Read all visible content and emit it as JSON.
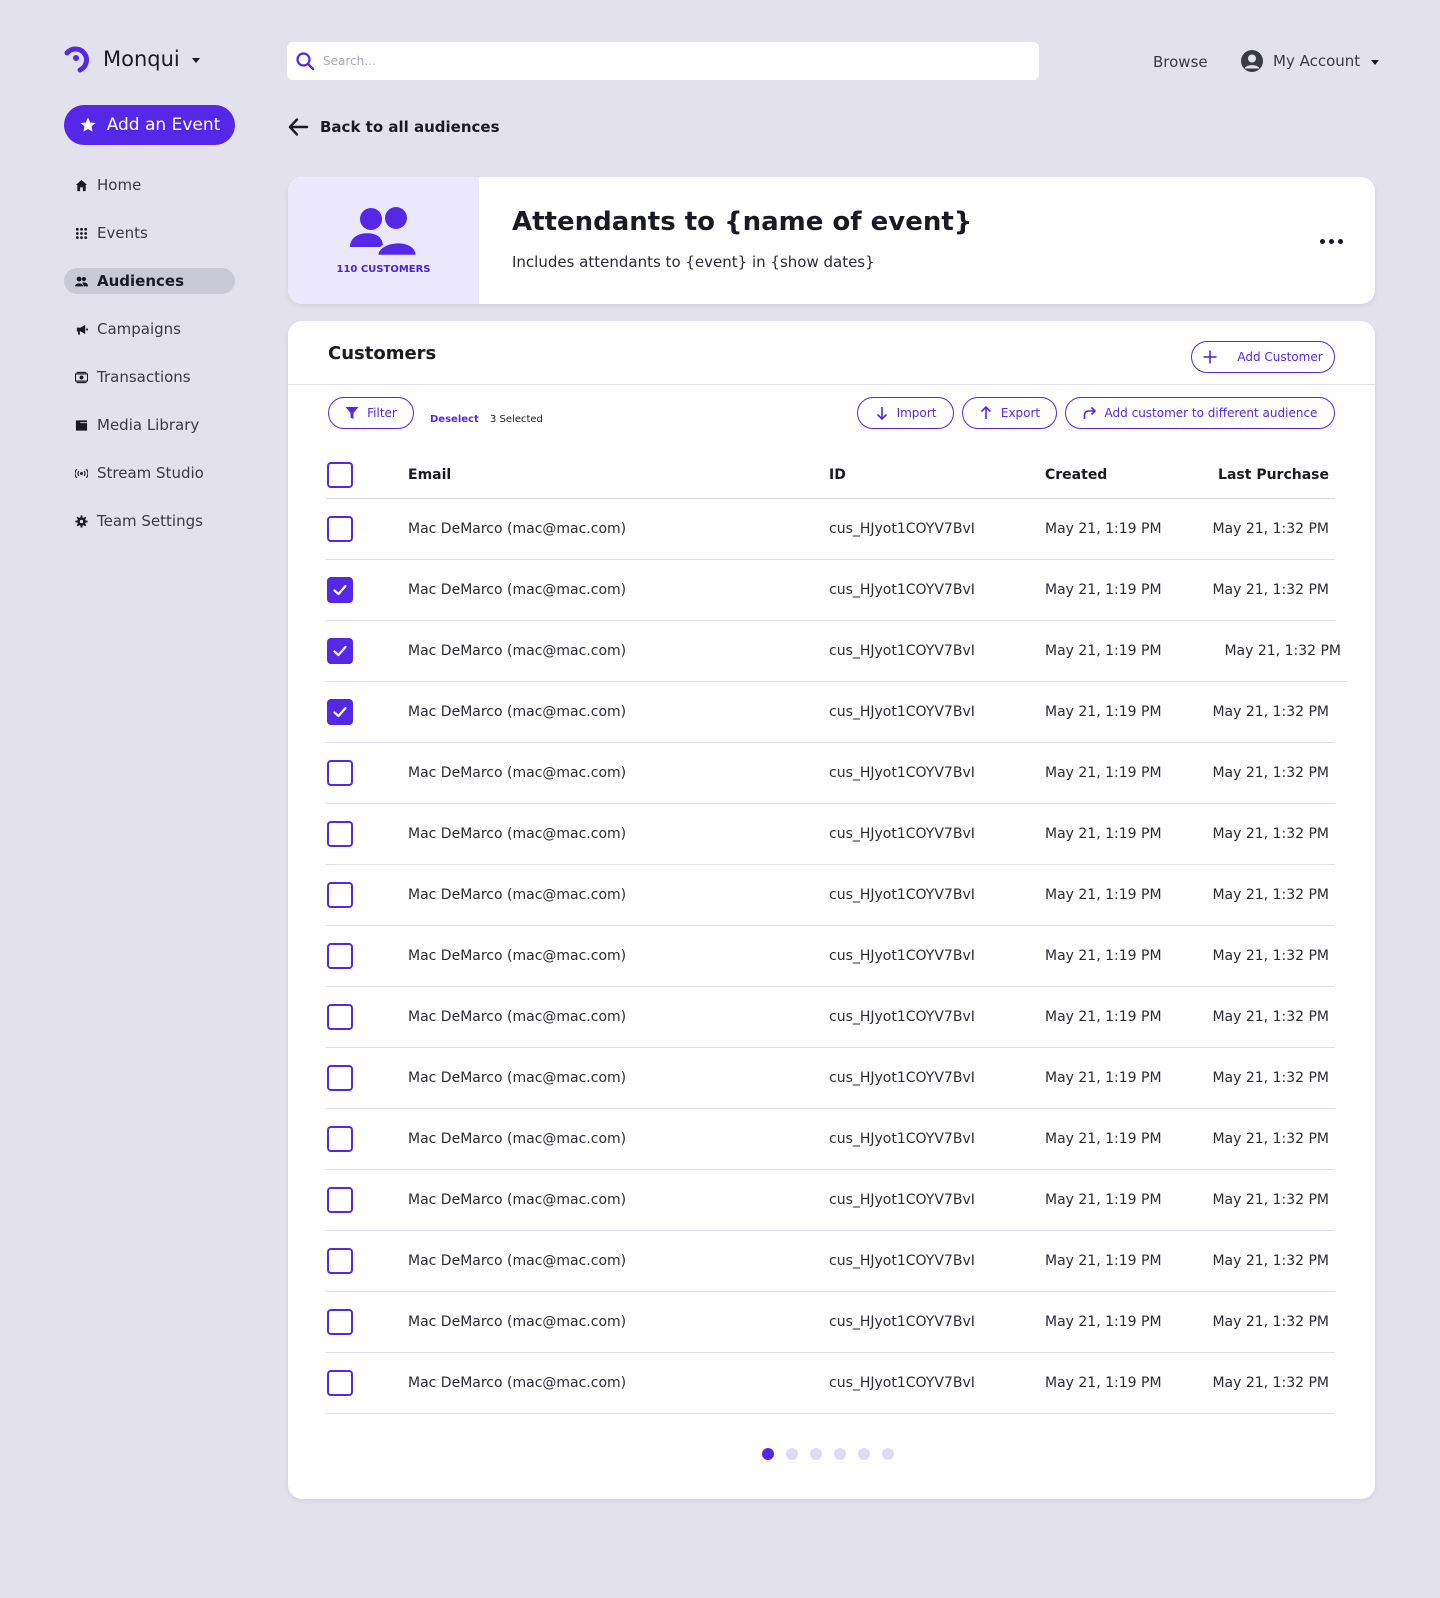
{
  "brand": {
    "name": "Monqui"
  },
  "search": {
    "placeholder": "Search..."
  },
  "header": {
    "browse": "Browse",
    "account": "My Account"
  },
  "sidebar": {
    "add_event": "Add an Event",
    "items": [
      {
        "label": "Home",
        "icon": "home-icon"
      },
      {
        "label": "Events",
        "icon": "grid-icon"
      },
      {
        "label": "Audiences",
        "icon": "users-icon",
        "active": true
      },
      {
        "label": "Campaigns",
        "icon": "megaphone-icon"
      },
      {
        "label": "Transactions",
        "icon": "money-icon"
      },
      {
        "label": "Media Library",
        "icon": "folder-icon"
      },
      {
        "label": "Stream Studio",
        "icon": "broadcast-icon"
      },
      {
        "label": "Team Settings",
        "icon": "gear-icon"
      }
    ]
  },
  "back": {
    "label": "Back to all audiences"
  },
  "audience": {
    "count_label": "110 CUSTOMERS",
    "title": "Attendants to {name of event}",
    "subtitle": "Includes attendants to {event} in {show dates}"
  },
  "customers": {
    "title": "Customers",
    "add_customer": "Add Customer",
    "filter": "Filter",
    "deselect": "Deselect",
    "selected_count": "3 Selected",
    "import": "Import",
    "export": "Export",
    "move": "Add customer to different audience",
    "columns": {
      "email": "Email",
      "id": "ID",
      "created": "Created",
      "last_purchase": "Last Purchase"
    },
    "rows": [
      {
        "email": "Mac DeMarco (mac@mac.com)",
        "id": "cus_HJyot1COYV7BvI",
        "created": "May 21, 1:19 PM",
        "last_purchase": "May 21, 1:32 PM",
        "checked": false
      },
      {
        "email": "Mac DeMarco (mac@mac.com)",
        "id": "cus_HJyot1COYV7BvI",
        "created": "May 21, 1:19 PM",
        "last_purchase": "May 21, 1:32 PM",
        "checked": true
      },
      {
        "email": "Mac DeMarco (mac@mac.com)",
        "id": "cus_HJyot1COYV7BvI",
        "created": "May 21, 1:19 PM",
        "last_purchase": "May 21, 1:32 PM",
        "checked": true
      },
      {
        "email": "Mac DeMarco (mac@mac.com)",
        "id": "cus_HJyot1COYV7BvI",
        "created": "May 21, 1:19 PM",
        "last_purchase": "May 21, 1:32 PM",
        "checked": true
      },
      {
        "email": "Mac DeMarco (mac@mac.com)",
        "id": "cus_HJyot1COYV7BvI",
        "created": "May 21, 1:19 PM",
        "last_purchase": "May 21, 1:32 PM",
        "checked": false
      },
      {
        "email": "Mac DeMarco (mac@mac.com)",
        "id": "cus_HJyot1COYV7BvI",
        "created": "May 21, 1:19 PM",
        "last_purchase": "May 21, 1:32 PM",
        "checked": false
      },
      {
        "email": "Mac DeMarco (mac@mac.com)",
        "id": "cus_HJyot1COYV7BvI",
        "created": "May 21, 1:19 PM",
        "last_purchase": "May 21, 1:32 PM",
        "checked": false
      },
      {
        "email": "Mac DeMarco (mac@mac.com)",
        "id": "cus_HJyot1COYV7BvI",
        "created": "May 21, 1:19 PM",
        "last_purchase": "May 21, 1:32 PM",
        "checked": false
      },
      {
        "email": "Mac DeMarco (mac@mac.com)",
        "id": "cus_HJyot1COYV7BvI",
        "created": "May 21, 1:19 PM",
        "last_purchase": "May 21, 1:32 PM",
        "checked": false
      },
      {
        "email": "Mac DeMarco (mac@mac.com)",
        "id": "cus_HJyot1COYV7BvI",
        "created": "May 21, 1:19 PM",
        "last_purchase": "May 21, 1:32 PM",
        "checked": false
      },
      {
        "email": "Mac DeMarco (mac@mac.com)",
        "id": "cus_HJyot1COYV7BvI",
        "created": "May 21, 1:19 PM",
        "last_purchase": "May 21, 1:32 PM",
        "checked": false
      },
      {
        "email": "Mac DeMarco (mac@mac.com)",
        "id": "cus_HJyot1COYV7BvI",
        "created": "May 21, 1:19 PM",
        "last_purchase": "May 21, 1:32 PM",
        "checked": false
      },
      {
        "email": "Mac DeMarco (mac@mac.com)",
        "id": "cus_HJyot1COYV7BvI",
        "created": "May 21, 1:19 PM",
        "last_purchase": "May 21, 1:32 PM",
        "checked": false
      },
      {
        "email": "Mac DeMarco (mac@mac.com)",
        "id": "cus_HJyot1COYV7BvI",
        "created": "May 21, 1:19 PM",
        "last_purchase": "May 21, 1:32 PM",
        "checked": false
      },
      {
        "email": "Mac DeMarco (mac@mac.com)",
        "id": "cus_HJyot1COYV7BvI",
        "created": "May 21, 1:19 PM",
        "last_purchase": "May 21, 1:32 PM",
        "checked": false
      }
    ]
  },
  "pagination": {
    "pages": 6,
    "current": 1
  },
  "colors": {
    "accent": "#5428e6",
    "background": "#e3e2ec",
    "accent_light": "#ece8fb",
    "active_nav": "#c9c8d7"
  }
}
